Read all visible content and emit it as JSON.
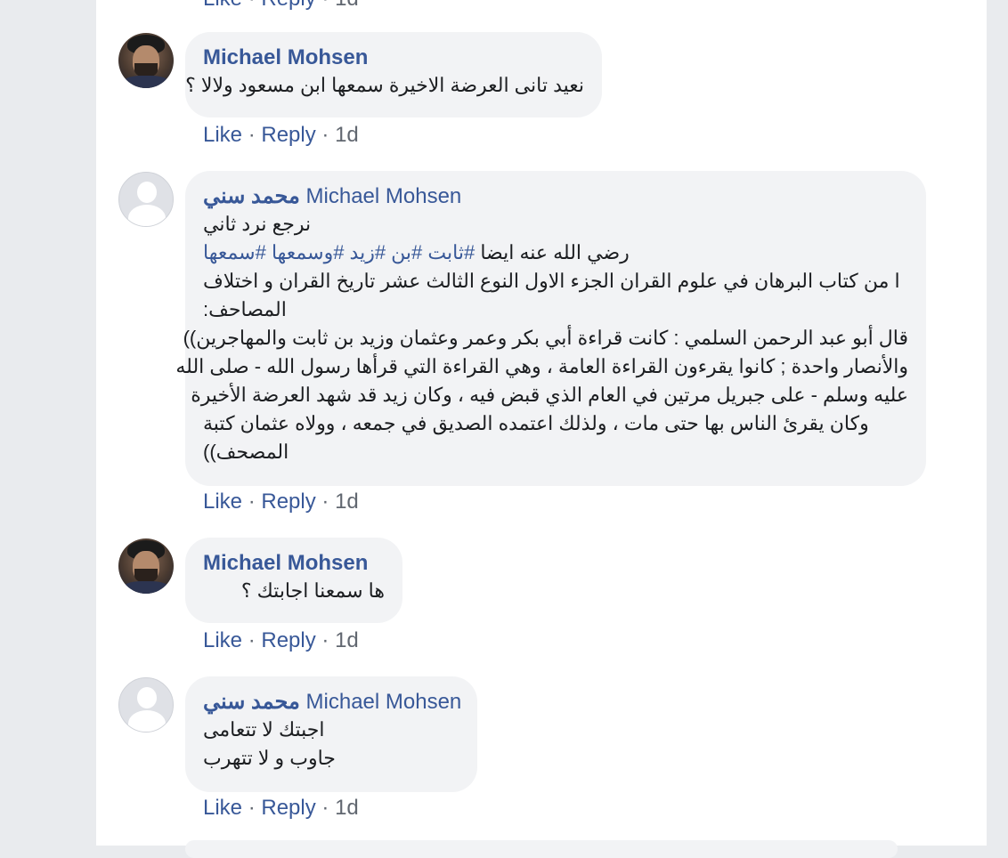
{
  "comments": [
    {
      "author": "Michael Mohsen",
      "text": "نعيد تانى العرضة الاخيرة سمعها ابن مسعود ولالا ؟",
      "like": "Like",
      "reply": "Reply",
      "time": "1d"
    },
    {
      "author": "محمد سني",
      "tagged": "Michael Mohsen",
      "lines": [
        "نرجع نرد ثاني",
        "رضي الله عنه ايضا",
        "ا من كتاب البرهان في علوم القران الجزء الاول النوع الثالث عشر تاريخ القران و اختلاف",
        "المصاحف:",
        "قال أبو عبد الرحمن السلمي : كانت قراءة أبي بكر وعمر وعثمان وزيد بن ثابت والمهاجرين))",
        "والأنصار واحدة ; كانوا يقرءون القراءة العامة ، وهي القراءة التي قرأها رسول الله - صلى الله",
        "عليه وسلم - على جبريل مرتين في العام الذي قبض فيه ، وكان زيد قد شهد العرضة الأخيرة",
        "وكان يقرئ الناس بها حتى مات ، ولذلك اعتمده الصديق في جمعه ، وولاه عثمان كتبة",
        "المصحف))"
      ],
      "hashtags": "#ثابت #بن #زيد #وسمعها #سمعها",
      "like": "Like",
      "reply": "Reply",
      "time": "1d"
    },
    {
      "author": "Michael Mohsen",
      "text": "ها سمعنا اجابتك ؟",
      "like": "Like",
      "reply": "Reply",
      "time": "1d"
    },
    {
      "author": "محمد سني",
      "tagged": "Michael Mohsen",
      "lines": [
        "اجبتك لا تتعامى",
        "جاوب و لا تتهرب"
      ],
      "like": "Like",
      "reply": "Reply",
      "time": "1d"
    }
  ],
  "top_actions": {
    "like": "Like",
    "reply": "Reply",
    "time": "1d"
  },
  "icons": {
    "photo_avatar": "user-photo-icon",
    "blank_avatar": "default-avatar-icon"
  },
  "colors": {
    "link": "#385898",
    "bubble": "#f2f3f5",
    "meta": "#616770"
  }
}
